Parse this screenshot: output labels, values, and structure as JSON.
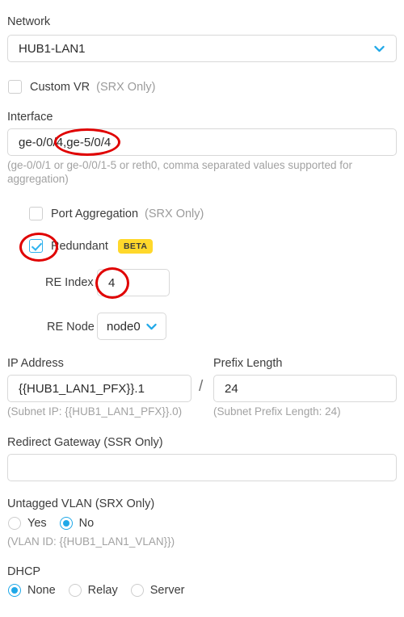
{
  "form": {
    "network": {
      "label": "Network",
      "value": "HUB1-LAN1",
      "icon": "chevron-down-icon"
    },
    "custom_vr": {
      "label": "Custom VR",
      "note": "(SRX Only)",
      "checked": false
    },
    "interface": {
      "label": "Interface",
      "value": "ge-0/0/4,ge-5/0/4",
      "hint": "(ge-0/0/1 or ge-0/0/1-5 or reth0, comma separated values supported for aggregation)"
    },
    "port_aggregation": {
      "label": "Port Aggregation",
      "note": "(SRX Only)",
      "checked": false
    },
    "redundant": {
      "label": "Redundant",
      "badge": "BETA",
      "checked": true
    },
    "re_index": {
      "label": "RE Index",
      "value": "4"
    },
    "re_node": {
      "label": "RE Node",
      "value": "node0",
      "icon": "chevron-down-icon"
    },
    "ip_address": {
      "label": "IP Address",
      "value": "{{HUB1_LAN1_PFX}}.1",
      "hint": "(Subnet IP: {{HUB1_LAN1_PFX}}.0)"
    },
    "separator": "/",
    "prefix_length": {
      "label": "Prefix Length",
      "value": "24",
      "hint": "(Subnet Prefix Length: 24)"
    },
    "redirect_gateway": {
      "label": "Redirect Gateway",
      "note": "(SSR Only)",
      "value": "",
      "placeholder": ""
    },
    "untagged_vlan": {
      "label": "Untagged VLAN",
      "note": "(SRX Only)",
      "options": [
        "Yes",
        "No"
      ],
      "selected": "No",
      "hint": "(VLAN ID: {{HUB1_LAN1_VLAN}})"
    },
    "dhcp": {
      "label": "DHCP",
      "options": [
        "None",
        "Relay",
        "Server"
      ],
      "selected": "None"
    }
  },
  "annotations": {
    "interface_highlight": "ge-5/0/4",
    "redundant_highlight": "checked",
    "re_index_highlight": "4",
    "color": "#e00000"
  },
  "colors": {
    "accent": "#1fa8e8",
    "badge_bg": "#ffd82b",
    "label": "#3c3c3c",
    "hint": "#a2a2a2",
    "border": "#d8d8d8"
  }
}
